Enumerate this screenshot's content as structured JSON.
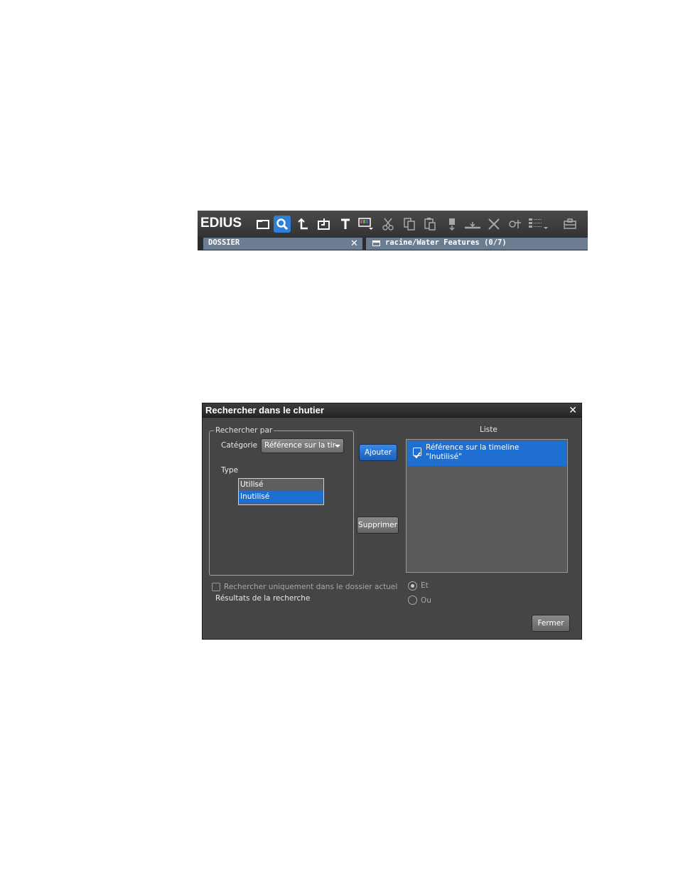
{
  "toolbar": {
    "logo": "EDIUS",
    "buttons": [
      {
        "name": "folder-icon",
        "active": false
      },
      {
        "name": "search-icon",
        "active": true
      },
      {
        "name": "up-arrow-icon",
        "active": false
      },
      {
        "name": "import-icon",
        "active": false
      },
      {
        "name": "title-icon",
        "active": false
      },
      {
        "name": "color-bars-icon",
        "active": false
      },
      {
        "name": "cut-icon",
        "active": false
      },
      {
        "name": "copy-icon",
        "active": false
      },
      {
        "name": "paste-icon",
        "active": false
      },
      {
        "name": "add-to-player-icon",
        "active": false
      },
      {
        "name": "add-to-timeline-icon",
        "active": false
      },
      {
        "name": "delete-icon",
        "active": false
      },
      {
        "name": "properties-icon",
        "active": false
      },
      {
        "name": "view-mode-icon",
        "active": false
      },
      {
        "name": "toolbox-icon",
        "active": false
      }
    ],
    "left_tab": {
      "label": "DOSSIER",
      "close": "✕"
    },
    "right_tab": {
      "label": "racine/Water Features (0/7)"
    }
  },
  "dialog": {
    "title": "Rechercher dans le chutier",
    "close": "✕",
    "group_label": "Rechercher par",
    "category_label": "Catégorie",
    "category_value": "Référence sur la tir",
    "type_label": "Type",
    "type_options": [
      {
        "label": "Utilisé",
        "selected": false
      },
      {
        "label": "Inutilisé",
        "selected": true
      }
    ],
    "add_button": "Ajouter",
    "remove_button": "Supprimer",
    "list_label": "Liste",
    "list_items": [
      {
        "line1": "Référence sur la timeline",
        "line2": "\"Inutilisé\"",
        "checked": true
      }
    ],
    "current_folder_only": "Rechercher uniquement dans le dossier actuel",
    "results_label": "Résultats de la recherche",
    "radio_and": "Et",
    "radio_or": "Ou",
    "close_button": "Fermer"
  },
  "colors": {
    "accent": "#1f6fd1",
    "dialog_bg": "#454545",
    "toolbar_bg": "#3a3a3a"
  }
}
